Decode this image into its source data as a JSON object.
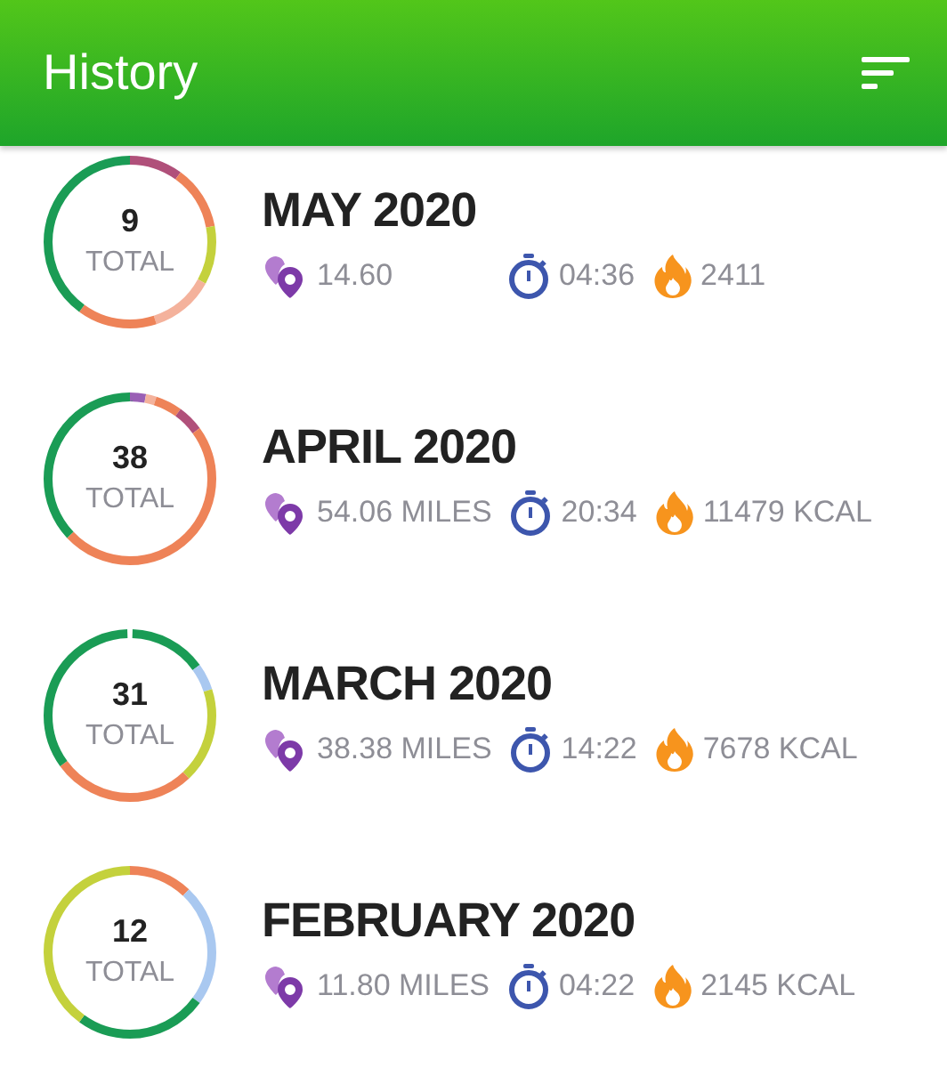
{
  "app_bar": {
    "title": "History"
  },
  "months": [
    {
      "total": "9",
      "total_label": "TOTAL",
      "title": "MAY 2020",
      "distance": "14.60",
      "duration": "04:36",
      "calories": "2411"
    },
    {
      "total": "38",
      "total_label": "TOTAL",
      "title": "APRIL 2020",
      "distance": "54.06 MILES",
      "duration": "20:34",
      "calories": "11479 KCAL"
    },
    {
      "total": "31",
      "total_label": "TOTAL",
      "title": "MARCH 2020",
      "distance": "38.38 MILES",
      "duration": "14:22",
      "calories": "7678 KCAL"
    },
    {
      "total": "12",
      "total_label": "TOTAL",
      "title": "FEBRUARY 2020",
      "distance": "11.80 MILES",
      "duration": "04:22",
      "calories": "2145 KCAL"
    }
  ]
}
